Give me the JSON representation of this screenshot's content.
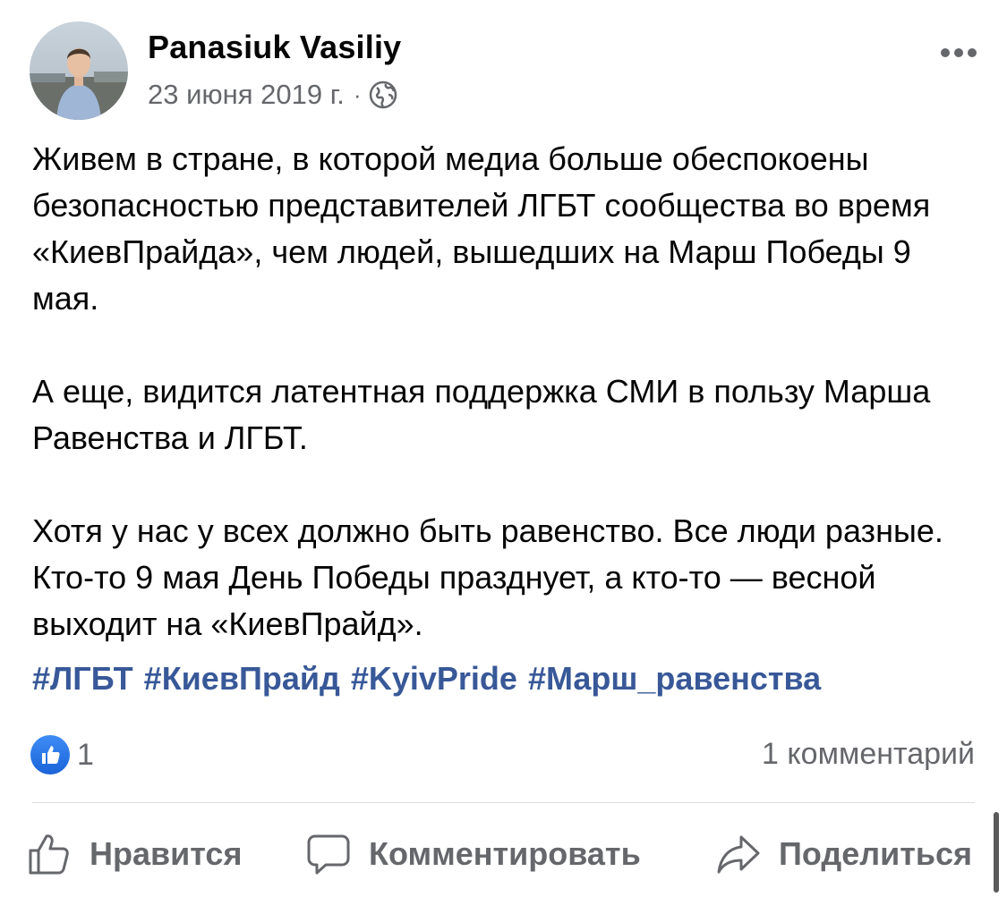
{
  "post": {
    "author": "Panasiuk Vasiliy",
    "date": "23 июня 2019 г.",
    "separator": "·",
    "privacy_icon": "globe-icon",
    "more_icon": "ellipsis-icon",
    "paragraphs": [
      "Живем в стране, в которой медиа больше обеспокоены безопасностью представителей ЛГБТ сообщества во время «КиевПрайда», чем людей, вышедших на Марш Победы 9 мая.",
      "А еще, видится латентная поддержка СМИ в пользу Марша Равенства и ЛГБТ.",
      "Хотя у нас у всех должно быть равенство. Все люди разные. Кто-то 9 мая День Победы празднует, а кто-то — весной выходит на «КиевПрайд»."
    ],
    "hashtags": [
      "#ЛГБТ",
      "#КиевПрайд",
      "#KyivPride",
      "#Марш_равенства"
    ],
    "reactions_count": "1",
    "reaction_icon": "like-reaction-icon",
    "comments_label": "1 комментарий"
  },
  "actions": {
    "like_label": "Нравится",
    "comment_label": "Комментировать",
    "share_label": "Поделиться"
  },
  "colors": {
    "link": "#385898",
    "secondary_text": "#65676b",
    "like_blue": "#1877f2",
    "divider": "#dadde1"
  }
}
